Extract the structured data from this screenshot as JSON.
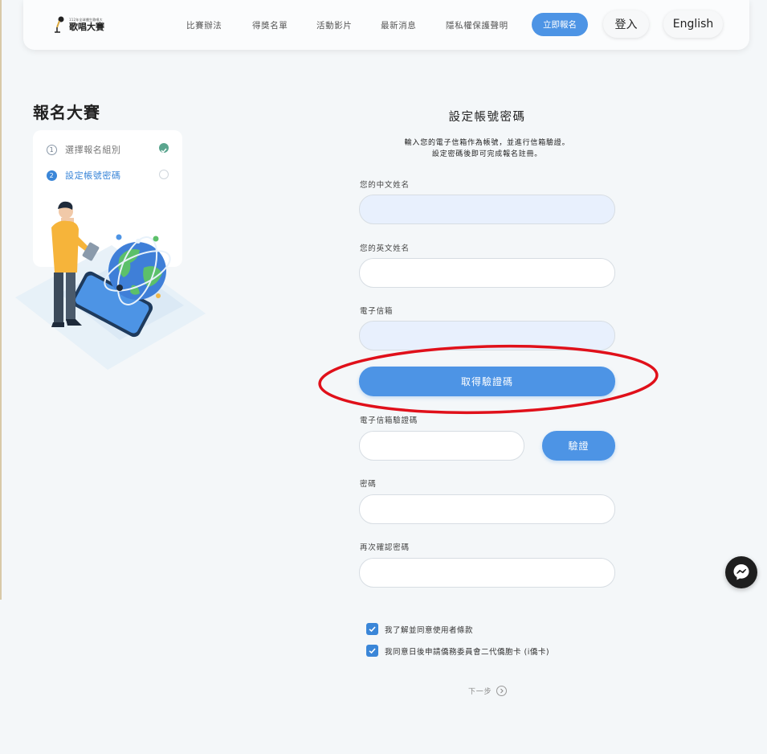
{
  "header": {
    "logo": {
      "small_text": "112年全球僑生歌唱大",
      "name": "歌唱大賽"
    },
    "nav": [
      {
        "label": "比賽辦法"
      },
      {
        "label": "得獎名單"
      },
      {
        "label": "活動影片"
      },
      {
        "label": "最新消息"
      },
      {
        "label": "隱私權保護聲明"
      }
    ],
    "signup_label": "立即報名",
    "login_label": "登入",
    "language_label": "English"
  },
  "sidebar": {
    "title": "報名大賽",
    "steps": [
      {
        "number": "1",
        "label": "選擇報名組別",
        "status": "done"
      },
      {
        "number": "2",
        "label": "設定帳號密碼",
        "status": "current"
      }
    ]
  },
  "form": {
    "title": "設定帳號密碼",
    "description_line1": "輸入您的電子信箱作為帳號，並進行信箱驗證。",
    "description_line2": "設定密碼後即可完成報名註冊。",
    "chinese_name_label": "您的中文姓名",
    "chinese_name_value": "",
    "english_name_label": "您的英文姓名",
    "english_name_value": "",
    "email_label": "電子信箱",
    "email_value": "",
    "get_code_label": "取得驗證碼",
    "code_label": "電子信箱驗證碼",
    "code_value": "",
    "verify_label": "驗證",
    "password_label": "密碼",
    "password_value": "",
    "confirm_password_label": "再次確認密碼",
    "confirm_password_value": "",
    "agree_terms_label": "我了解並同意使用者條款",
    "agree_terms_checked": true,
    "agree_card_label": "我同意日後申請僑務委員會二代僑胞卡 (i僑卡)",
    "agree_card_checked": true,
    "next_label": "下一步"
  },
  "colors": {
    "accent": "#4d94e5",
    "step_done": "#5aa58e",
    "highlight_ring": "#e0101a"
  },
  "icons": {
    "messenger": "messenger-icon",
    "next": "chevron-right-circle-icon"
  }
}
